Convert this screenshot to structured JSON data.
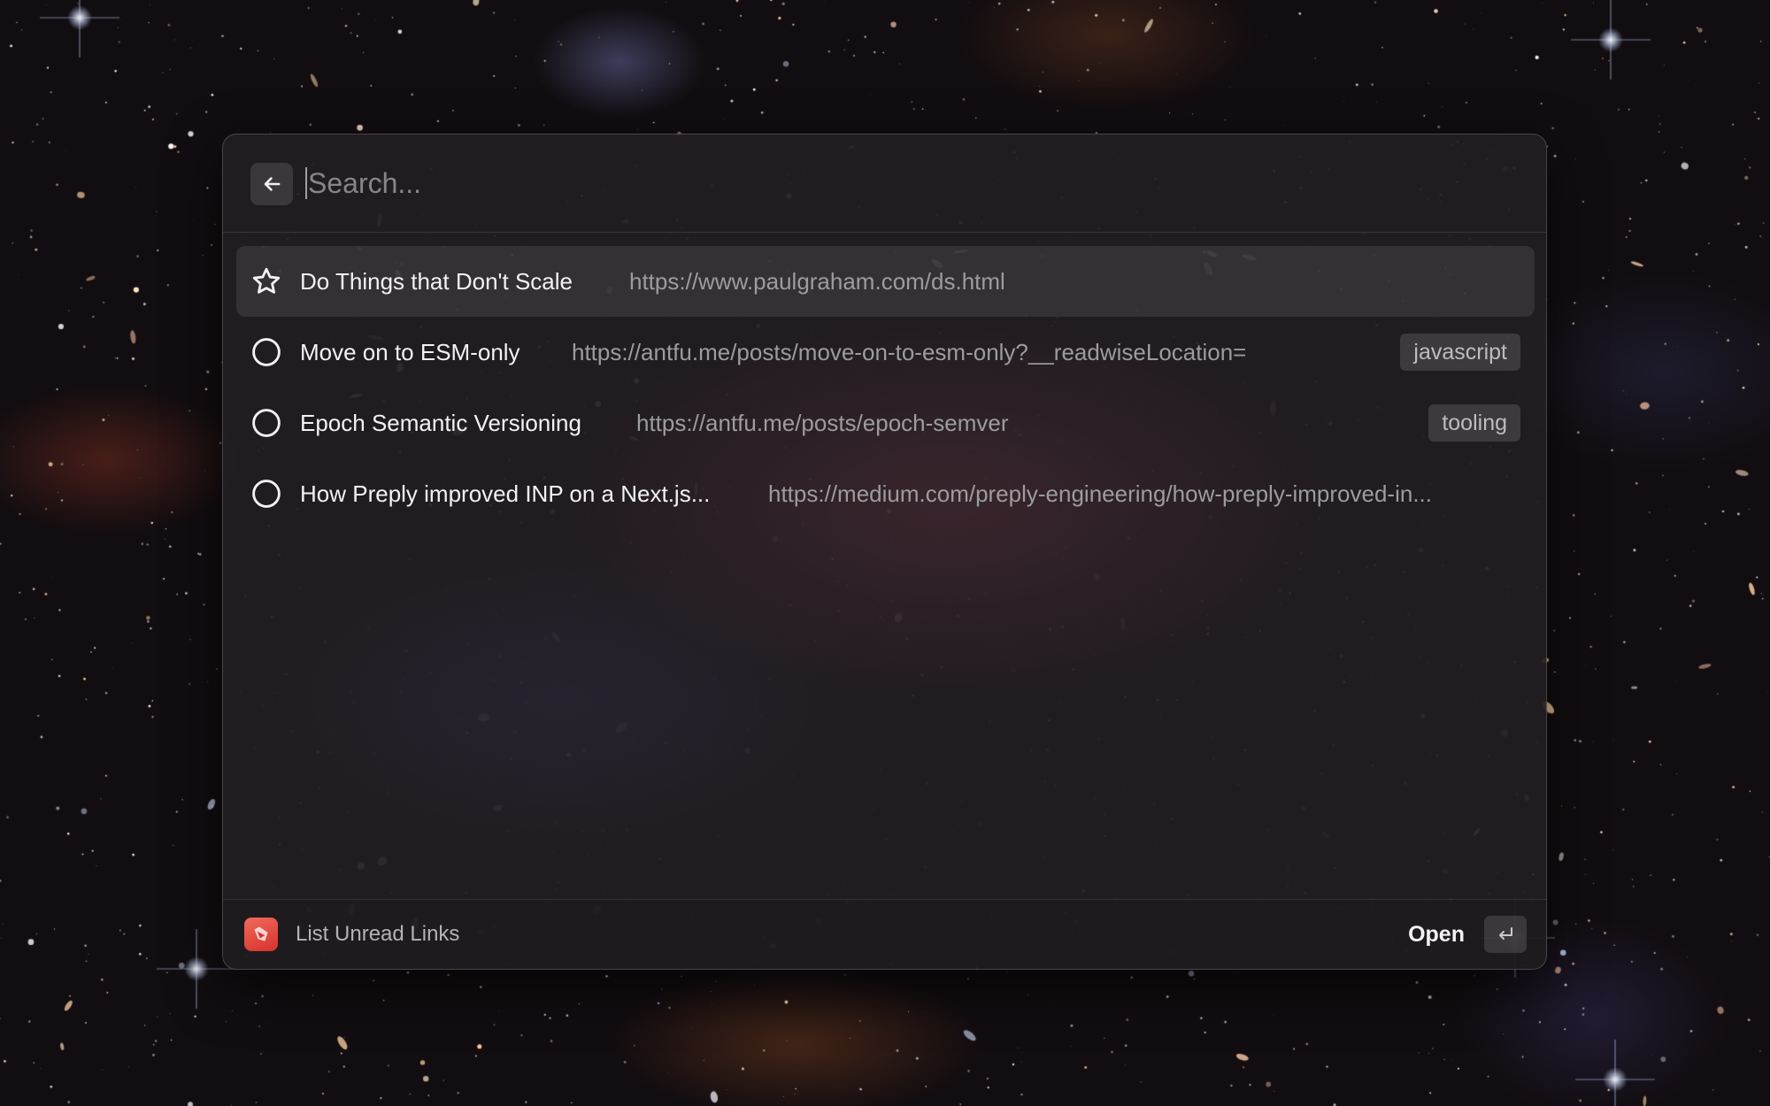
{
  "search": {
    "placeholder": "Search...",
    "value": ""
  },
  "icons": {
    "back": "arrow-left-icon",
    "favorite": "star-icon",
    "unread": "circle-icon",
    "app": "readwise-icon",
    "enter": "return-key-icon"
  },
  "items": [
    {
      "title": "Do Things that Don't Scale",
      "url": "https://www.paulgraham.com/ds.html",
      "tag": "",
      "icon": "star-icon",
      "selected": true
    },
    {
      "title": "Move on to ESM-only",
      "url": "https://antfu.me/posts/move-on-to-esm-only?__readwiseLocation=",
      "tag": "javascript",
      "icon": "circle-icon",
      "selected": false
    },
    {
      "title": "Epoch Semantic Versioning",
      "url": "https://antfu.me/posts/epoch-semver",
      "tag": "tooling",
      "icon": "circle-icon",
      "selected": false
    },
    {
      "title": "How Preply improved INP on a Next.js...",
      "url": "https://medium.com/preply-engineering/how-preply-improved-in...",
      "tag": "",
      "icon": "circle-icon",
      "selected": false
    }
  ],
  "footer": {
    "title": "List Unread Links",
    "action_label": "Open"
  },
  "colors": {
    "app_icon": "#e5463b",
    "selected_row": "#3a3639",
    "tag_bg": "#48454a"
  }
}
